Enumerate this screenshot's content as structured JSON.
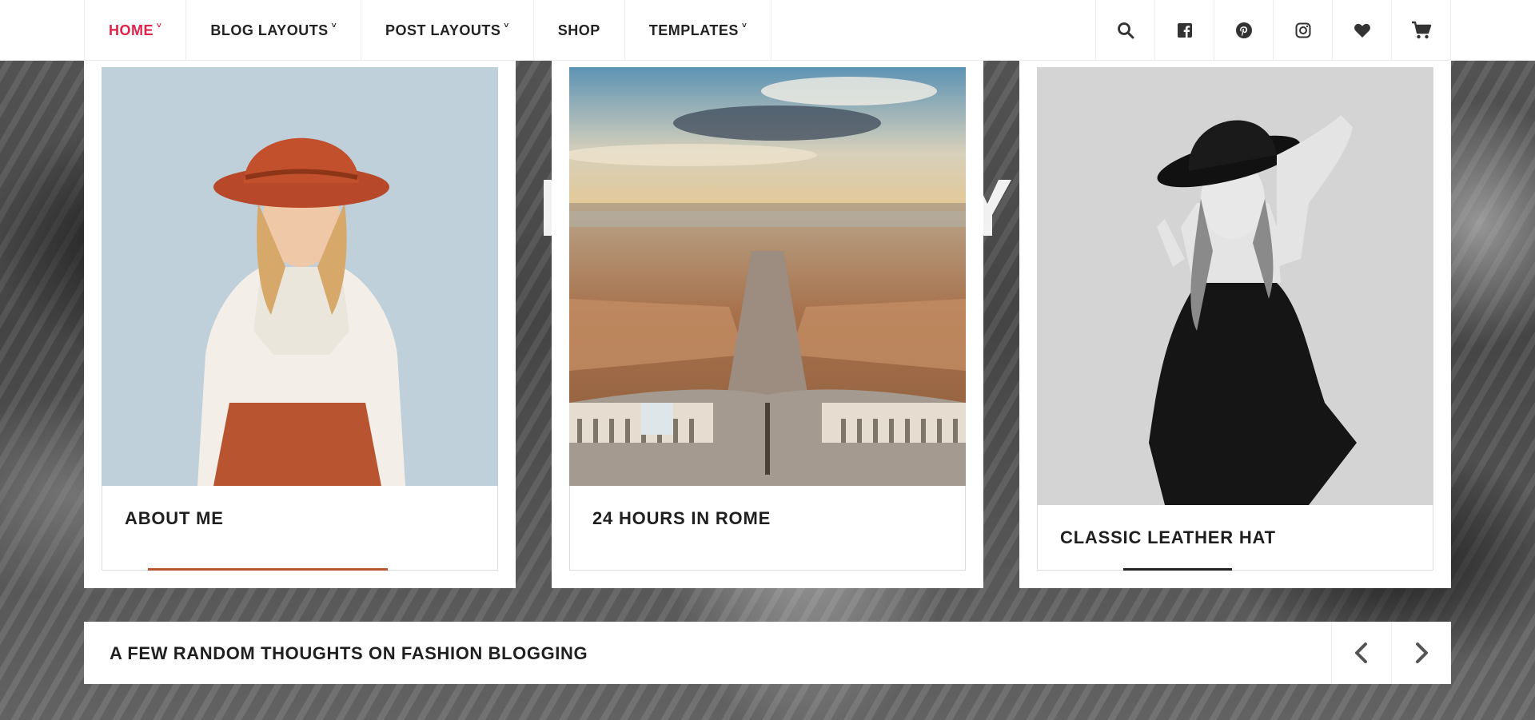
{
  "nav": {
    "items": [
      {
        "label": "HOME",
        "has_dropdown": true,
        "active": true
      },
      {
        "label": "BLOG LAYOUTS",
        "has_dropdown": true,
        "active": false
      },
      {
        "label": "POST LAYOUTS",
        "has_dropdown": true,
        "active": false
      },
      {
        "label": "SHOP",
        "has_dropdown": false,
        "active": false
      },
      {
        "label": "TEMPLATES",
        "has_dropdown": true,
        "active": false
      }
    ],
    "dropdown_glyph": "˅",
    "icons": [
      "search-icon",
      "facebook-icon",
      "pinterest-icon",
      "instagram-icon",
      "heart-icon",
      "cart-icon"
    ],
    "active_color": "#e0224a"
  },
  "slider": {
    "cards": [
      {
        "title": "ABOUT ME"
      },
      {
        "title": "24 HOURS IN ROME"
      },
      {
        "title": "CLASSIC LEATHER HAT"
      }
    ]
  },
  "ticker": {
    "text": "A FEW RANDOM THOUGHTS ON FASHION BLOGGING",
    "prev_icon": "chevron-left-icon",
    "next_icon": "chevron-right-icon"
  }
}
